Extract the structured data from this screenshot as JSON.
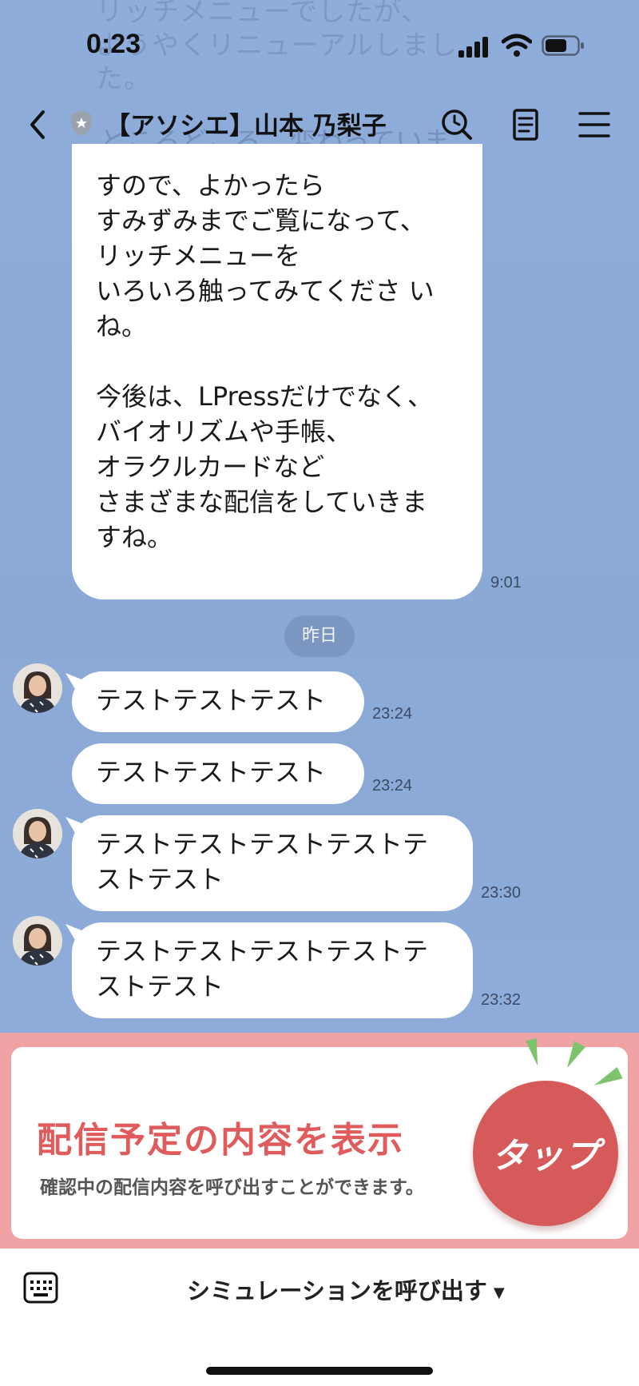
{
  "status_bar": {
    "time": "0:23"
  },
  "background_ghost_text": [
    "リッチメニューでしたが、",
    "ようやくリニューアルしまし",
    "た。"
  ],
  "background_ghost_line": "ところどころ、変わっていま",
  "header": {
    "title": "【アソシエ】山本 乃梨子"
  },
  "messages": {
    "long": {
      "lines_a": [
        "すので、よかったら",
        "すみずみまでご覧になって、",
        "リッチメニューを",
        "いろいろ触ってみてくださ い",
        "ね。"
      ],
      "lines_b": [
        "今後は、LPressだけでなく、",
        "バイオリズムや手帳、",
        "オラクルカードなど",
        "さまざまな配信をしていきま",
        "すね。"
      ],
      "time": "9:01"
    },
    "date_divider": "昨日",
    "m1": {
      "text": "テストテストテスト",
      "time": "23:24"
    },
    "m2": {
      "text": "テストテストテスト",
      "time": "23:24"
    },
    "m3": {
      "lines": [
        "テストテストテストテストテ",
        "ストテスト"
      ],
      "time": "23:30"
    },
    "m4": {
      "lines": [
        "テストテストテストテストテ",
        "ストテスト"
      ],
      "time": "23:32"
    }
  },
  "rich_menu": {
    "title": "配信予定の内容を表示",
    "subtitle": "確認中の配信内容を呼び出すことができます。",
    "tap_label": "タップ"
  },
  "bottom_bar": {
    "menu_label": "シミュレーションを呼び出す"
  },
  "colors": {
    "chat_bg": "#8eacd9",
    "rich_bg": "#f0a3a4",
    "accent_red": "#df5b5c",
    "tap_red": "#d75a5a"
  }
}
